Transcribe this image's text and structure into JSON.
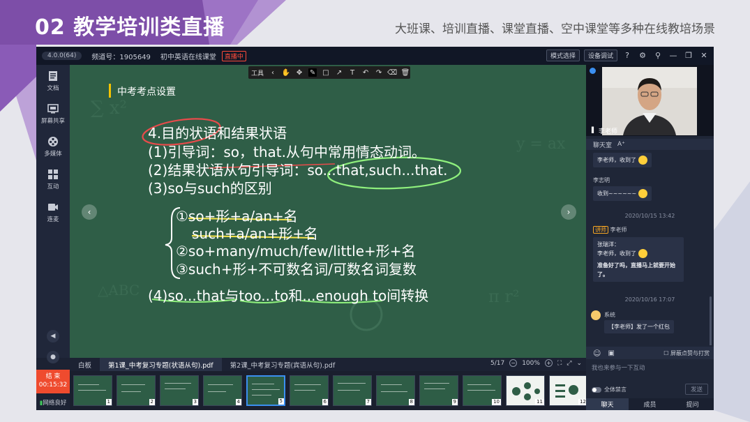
{
  "banner": {
    "number": "02",
    "title": "教学培训类直播",
    "subtitle": "大班课、培训直播、课堂直播、空中课堂等多种在线教培场景"
  },
  "titlebar": {
    "version": "4.0.0(64)",
    "channel": "频道号：1905649",
    "course": "初中英语在线课堂",
    "live_badge": "直播中",
    "mode_btn": "模式选择",
    "device_btn": "设备调试"
  },
  "sidebar": {
    "items": [
      {
        "label": "文档",
        "icon": "document-icon"
      },
      {
        "label": "屏幕共享",
        "icon": "screen-share-icon"
      },
      {
        "label": "多媒体",
        "icon": "media-icon"
      },
      {
        "label": "互动",
        "icon": "interaction-icon"
      },
      {
        "label": "连麦",
        "icon": "camera-icon"
      }
    ],
    "end_label": "结 束",
    "timer": "00:15:32",
    "network": "网络良好"
  },
  "board": {
    "tool_label": "工具",
    "lesson_title": "中考考点设置",
    "lines": [
      "4.目的状语和结果状语",
      "(1)引导词：so，that.从句中常用情态动词。",
      "(2)结果状语从句引导词：so...that,such...that.",
      "(3)so与such的区别",
      "①so+形+a/an+名",
      "such+a/an+形+名",
      "②so+many/much/few/little+形+名",
      "③such+形+不可数名词/可数名词复数",
      "(4)so...that与too...to和...enough to间转换"
    ]
  },
  "docbar": {
    "tabs": [
      "白板",
      "第1课_中考复习专题(状语从句).pdf",
      "第2课_中考复习专题(宾语从句).pdf"
    ],
    "page": "5/17",
    "zoom": "100%"
  },
  "thumbs": [
    "1",
    "2",
    "3",
    "4",
    "5",
    "6",
    "7",
    "8",
    "9",
    "10",
    "11",
    "12"
  ],
  "right": {
    "teacher_name": "李老师",
    "chat_tab": "聊天室",
    "font_btn": "A⁺",
    "messages": [
      {
        "text": "李老师，收到了"
      },
      {
        "name": "李志明",
        "text": "收到~~~~~~"
      },
      {
        "time": "2020/10/15 13:42"
      },
      {
        "role": "讲师",
        "name": "李老师",
        "quote": "张瑞洋：",
        "quote_text": "李老师，收到了",
        "text": "准备好了吗，直播马上就要开始了。"
      },
      {
        "time": "2020/10/16 17:07"
      },
      {
        "name": "系统",
        "text": "【李老师】发了一个红包"
      }
    ],
    "block_label": "屏蔽点赞与打赏",
    "input_placeholder": "我也来参与一下互动",
    "mute_label": "全体禁言",
    "send_label": "发送",
    "tabs": [
      "聊天",
      "成员",
      "提问"
    ]
  }
}
